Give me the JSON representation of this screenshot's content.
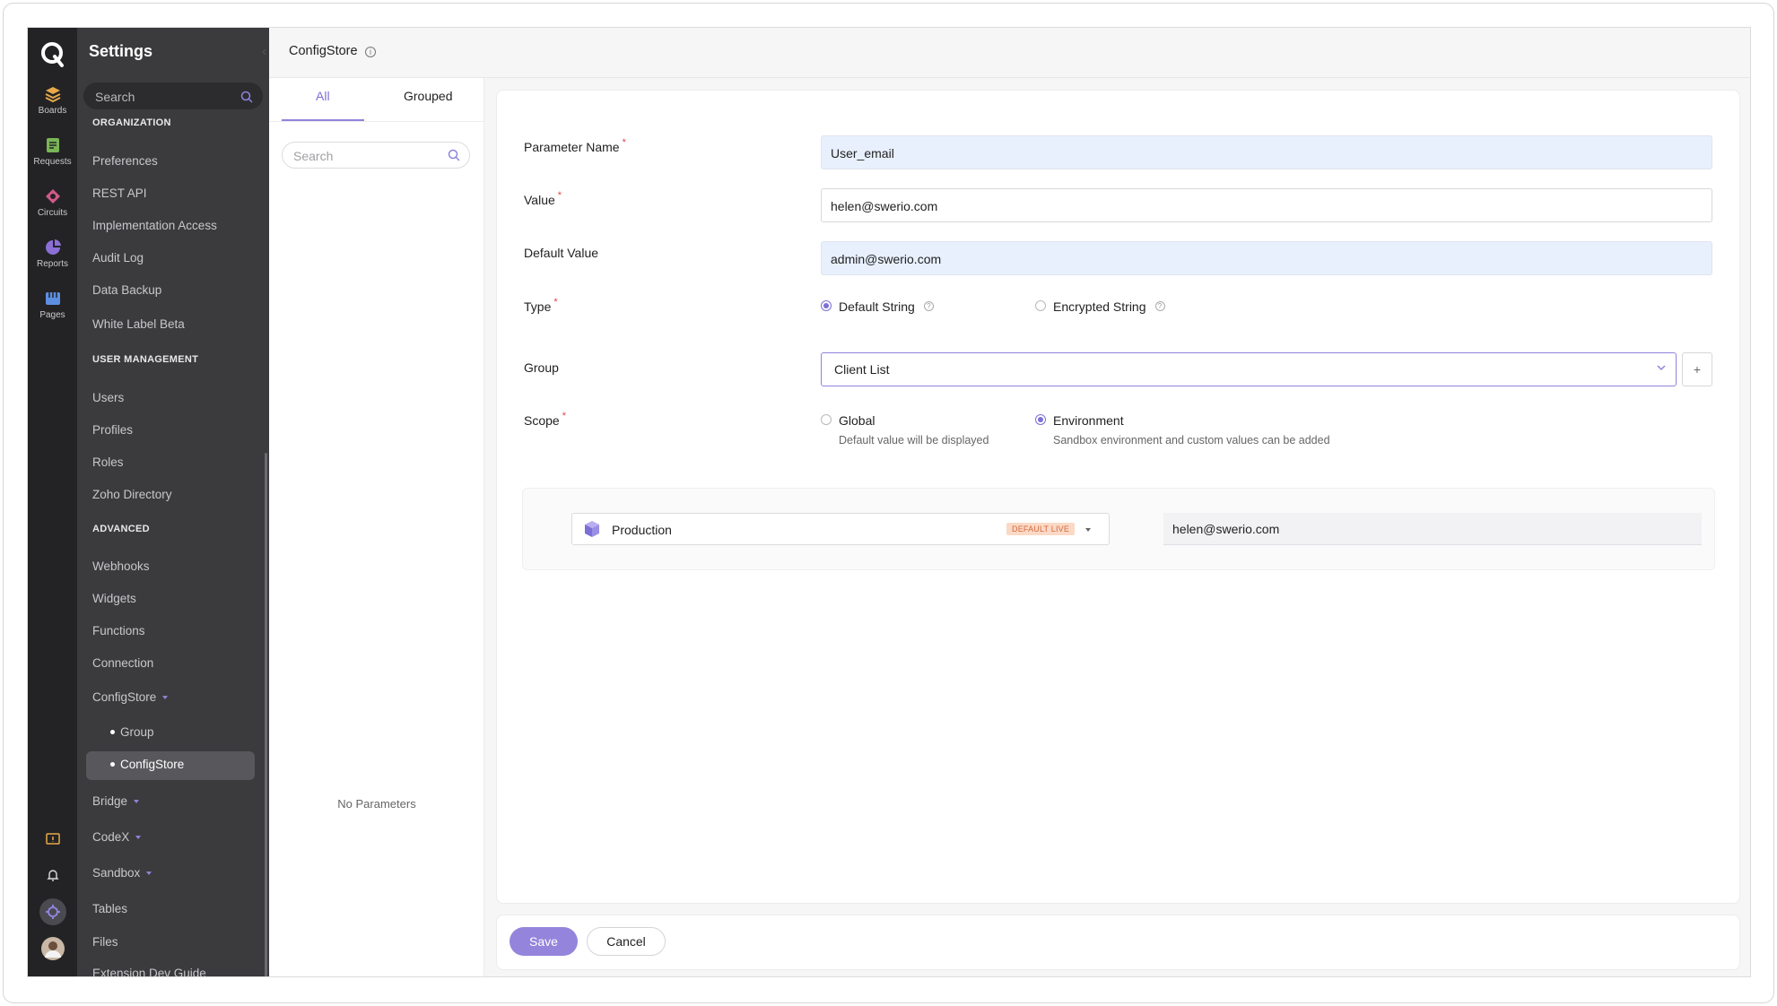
{
  "app": {
    "section_title": "Settings",
    "page_title": "ConfigStore"
  },
  "rail": {
    "items": [
      {
        "label": "Boards",
        "icon": "stack-icon",
        "color": "#e7a94a"
      },
      {
        "label": "Requests",
        "icon": "document-icon",
        "color": "#79b556"
      },
      {
        "label": "Circuits",
        "icon": "circuit-icon",
        "color": "#d05a8a"
      },
      {
        "label": "Reports",
        "icon": "pie-chart-icon",
        "color": "#8b6fd6"
      },
      {
        "label": "Pages",
        "icon": "pages-icon",
        "color": "#5d8fe0"
      }
    ]
  },
  "sidebar": {
    "search_placeholder": "Search",
    "sections": [
      {
        "title": "ORGANIZATION",
        "items": [
          "Preferences",
          "REST API",
          "Implementation Access",
          "Audit Log",
          "Data Backup",
          "White Label Beta"
        ]
      },
      {
        "title": "USER MANAGEMENT",
        "items": [
          "Users",
          "Profiles",
          "Roles",
          "Zoho Directory"
        ]
      },
      {
        "title": "ADVANCED",
        "items": [
          "Webhooks",
          "Widgets",
          "Functions",
          "Connection",
          "ConfigStore",
          "Group",
          "ConfigStore",
          "Bridge",
          "CodeX",
          "Sandbox",
          "Tables",
          "Files",
          "Extension Dev Guide"
        ]
      }
    ]
  },
  "list": {
    "tabs": [
      "All",
      "Grouped"
    ],
    "search_placeholder": "Search",
    "empty_text": "No Parameters"
  },
  "form": {
    "parameter_name": {
      "label": "Parameter Name",
      "value": "User_email"
    },
    "value": {
      "label": "Value",
      "value": "helen@swerio.com"
    },
    "default_value": {
      "label": "Default Value",
      "value": "admin@swerio.com"
    },
    "type": {
      "label": "Type",
      "options": [
        "Default String",
        "Encrypted String"
      ],
      "selected": "Default String"
    },
    "group": {
      "label": "Group",
      "value": "Client List",
      "add_label": "+"
    },
    "scope": {
      "label": "Scope",
      "options": [
        {
          "label": "Global",
          "desc": "Default value will be displayed"
        },
        {
          "label": "Environment",
          "desc": "Sandbox environment and custom values can be added"
        }
      ],
      "selected": "Environment"
    },
    "environment": {
      "name": "Production",
      "badge": "DEFAULT LIVE",
      "value": "helen@swerio.com"
    }
  },
  "footer": {
    "save_label": "Save",
    "cancel_label": "Cancel"
  },
  "colors": {
    "accent": "#8f84dc",
    "required": "#e04545",
    "badge_bg": "#fbd9c6",
    "badge_text": "#d4693a"
  }
}
